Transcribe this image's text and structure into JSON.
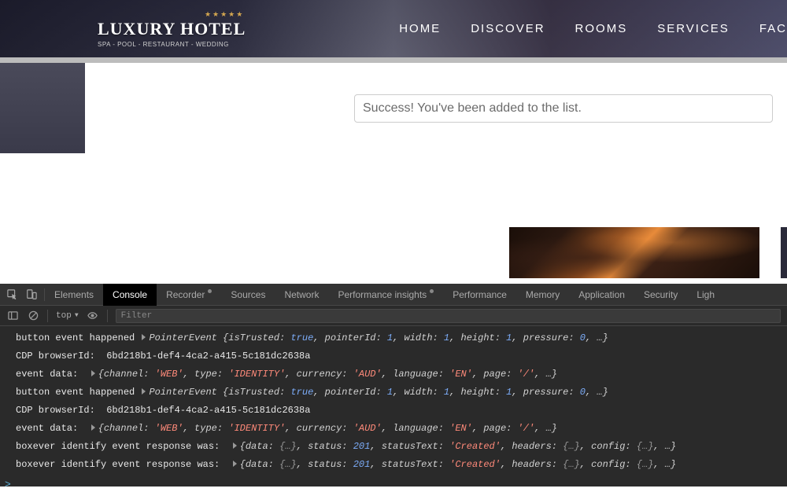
{
  "logo": {
    "stars": "★★★★★",
    "name": "LUXURY HOTEL",
    "tagline": "SPA - POOL - RESTAURANT - WEDDING"
  },
  "nav": [
    "HOME",
    "DISCOVER",
    "ROOMS",
    "SERVICES",
    "FAC"
  ],
  "input_value": "Success! You've been added to the list.",
  "devtools": {
    "tabs": [
      "Elements",
      "Console",
      "Recorder",
      "Sources",
      "Network",
      "Performance insights",
      "Performance",
      "Memory",
      "Application",
      "Security",
      "Ligh"
    ],
    "active_tab": "Console",
    "context": "top",
    "context_arrow": "▼",
    "filter_placeholder": "Filter",
    "prompt": ">",
    "rows": [
      {
        "t": "pointer",
        "label": "button event happened",
        "ev": "PointerEvent",
        "isTrusted": "true",
        "pointerId": "1",
        "width": "1",
        "height": "1",
        "pressure": "0"
      },
      {
        "t": "cdp",
        "label": "CDP browserId:",
        "id": "6bd218b1-def4-4ca2-a415-5c181dc2638a"
      },
      {
        "t": "event",
        "label": "event data:",
        "channel": "'WEB'",
        "type": "'IDENTITY'",
        "currency": "'AUD'",
        "language": "'EN'",
        "page": "'/'"
      },
      {
        "t": "pointer",
        "label": "button event happened",
        "ev": "PointerEvent",
        "isTrusted": "true",
        "pointerId": "1",
        "width": "1",
        "height": "1",
        "pressure": "0"
      },
      {
        "t": "cdp",
        "label": "CDP browserId:",
        "id": "6bd218b1-def4-4ca2-a415-5c181dc2638a"
      },
      {
        "t": "event",
        "label": "event data:",
        "channel": "'WEB'",
        "type": "'IDENTITY'",
        "currency": "'AUD'",
        "language": "'EN'",
        "page": "'/'"
      },
      {
        "t": "resp",
        "label": "boxever identify event response was:",
        "status": "201",
        "statusText": "'Created'"
      },
      {
        "t": "resp",
        "label": "boxever identify event response was:",
        "status": "201",
        "statusText": "'Created'"
      }
    ]
  }
}
